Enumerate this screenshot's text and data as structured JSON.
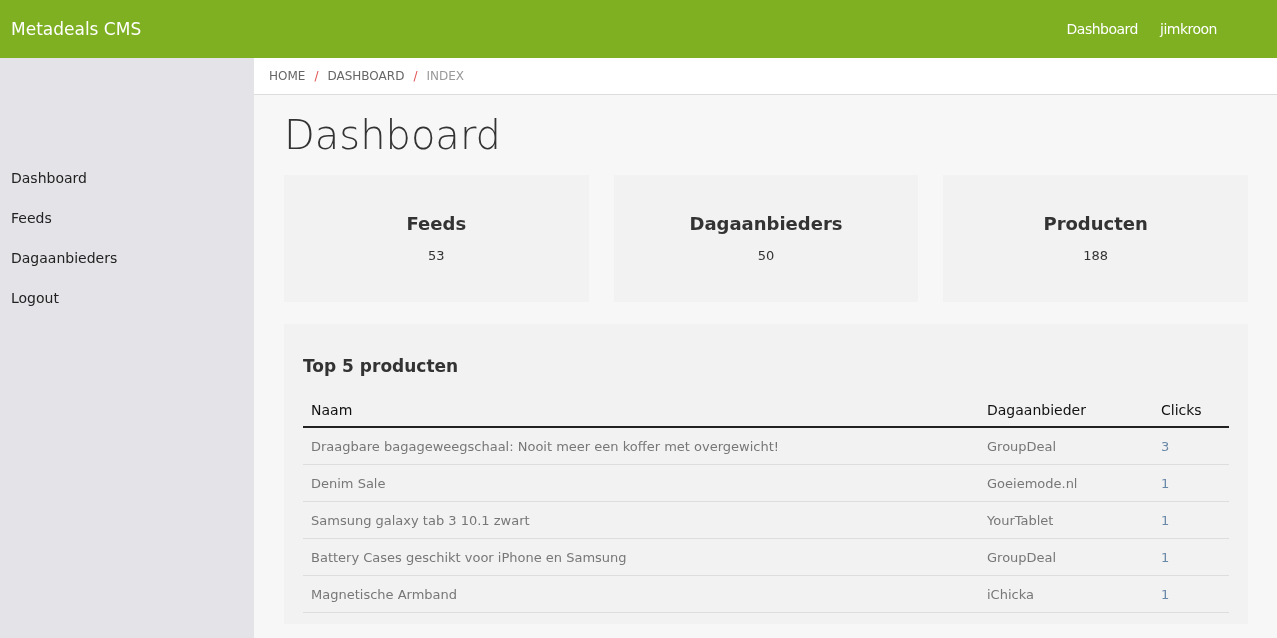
{
  "header": {
    "brand": "Metadeals CMS",
    "nav": [
      {
        "label": "Dashboard"
      },
      {
        "label": "jimkroon"
      }
    ]
  },
  "sidebar": {
    "items": [
      {
        "label": "Dashboard"
      },
      {
        "label": "Feeds"
      },
      {
        "label": "Dagaanbieders"
      },
      {
        "label": "Logout"
      }
    ]
  },
  "breadcrumb": [
    {
      "label": "HOME"
    },
    {
      "label": "DASHBOARD"
    },
    {
      "label": "INDEX"
    }
  ],
  "breadcrumb_separator": "/",
  "title": "Dashboard",
  "stats": [
    {
      "title": "Feeds",
      "value": "53"
    },
    {
      "title": "Dagaanbieders",
      "value": "50"
    },
    {
      "title": "Producten",
      "value": "188"
    }
  ],
  "table": {
    "title": "Top 5 producten",
    "columns": [
      "Naam",
      "Dagaanbieder",
      "Clicks"
    ],
    "rows": [
      [
        "Draagbare bagageweegschaal: Nooit meer een koffer met overgewicht!",
        "GroupDeal",
        "3"
      ],
      [
        "Denim Sale",
        "Goeiemode.nl",
        "1"
      ],
      [
        "Samsung galaxy tab 3 10.1 zwart",
        "YourTablet",
        "1"
      ],
      [
        "Battery Cases geschikt voor iPhone en Samsung",
        "GroupDeal",
        "1"
      ],
      [
        "Magnetische Armband",
        "iChicka",
        "1"
      ]
    ]
  }
}
